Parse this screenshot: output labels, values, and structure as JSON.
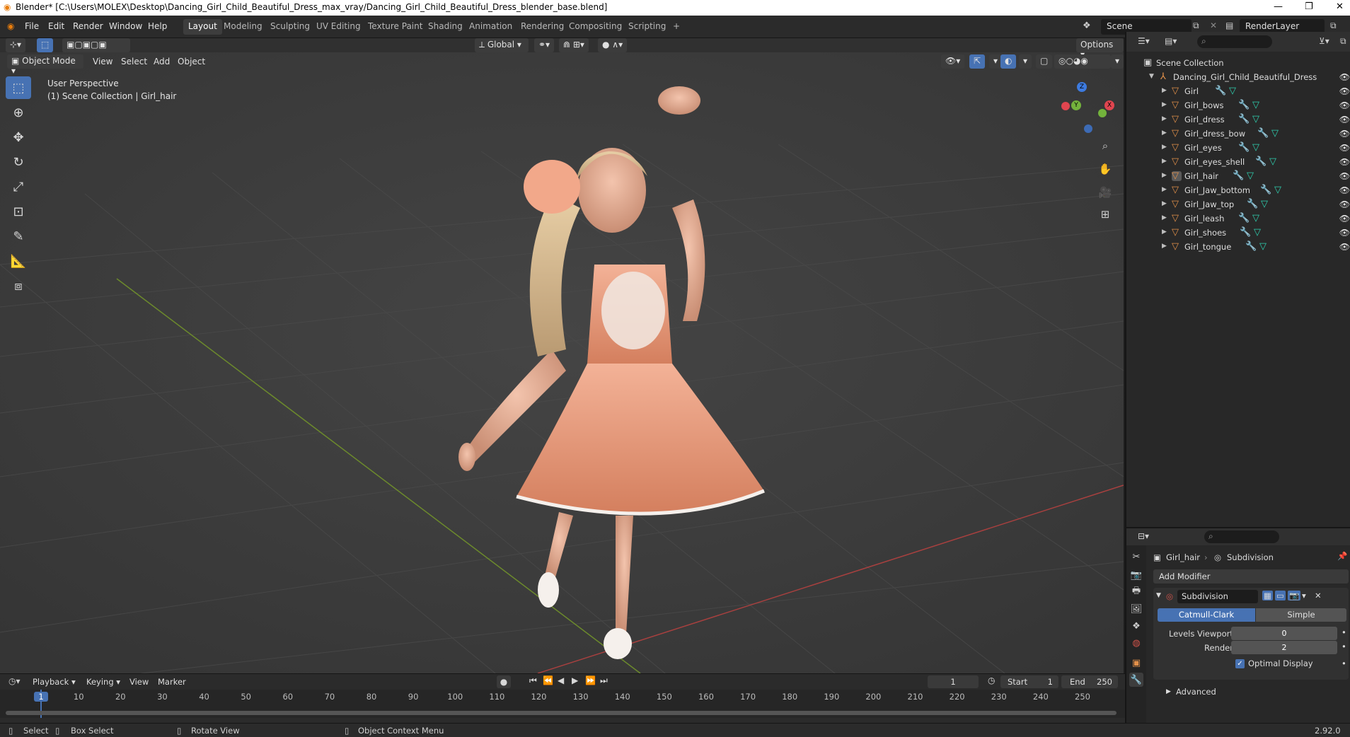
{
  "window": {
    "title": "Blender* [C:\\Users\\MOLEX\\Desktop\\Dancing_Girl_Child_Beautiful_Dress_max_vray/Dancing_Girl_Child_Beautiful_Dress_blender_base.blend]"
  },
  "menu": [
    "File",
    "Edit",
    "Render",
    "Window",
    "Help"
  ],
  "workspaces": [
    "Layout",
    "Modeling",
    "Sculpting",
    "UV Editing",
    "Texture Paint",
    "Shading",
    "Animation",
    "Rendering",
    "Compositing",
    "Scripting"
  ],
  "workspace_add": "+",
  "scene": {
    "name": "Scene",
    "view_layer": "RenderLayer"
  },
  "viewport_header": {
    "transform_orientation": "Global",
    "options": "Options",
    "mode": "Object Mode",
    "menus": [
      "View",
      "Select",
      "Add",
      "Object"
    ]
  },
  "viewport": {
    "perspective_label": "User Perspective",
    "collection_label": "(1) Scene Collection | Girl_hair",
    "gizmo": {
      "x": "X",
      "y": "Y",
      "z": "Z"
    }
  },
  "outliner": {
    "root": "Scene Collection",
    "collection": "Dancing_Girl_Child_Beautiful_Dress",
    "objects": [
      "Girl",
      "Girl_bows",
      "Girl_dress",
      "Girl_dress_bow",
      "Girl_eyes",
      "Girl_eyes_shell",
      "Girl_hair",
      "Girl_Jaw_bottom",
      "Girl_Jaw_top",
      "Girl_leash",
      "Girl_shoes",
      "Girl_tongue"
    ],
    "selected": "Girl_hair"
  },
  "properties": {
    "object": "Girl_hair",
    "modifier_context": "Subdivision",
    "add_modifier": "Add Modifier",
    "modifier_name": "Subdivision",
    "algorithm_options": [
      "Catmull-Clark",
      "Simple"
    ],
    "algorithm_selected": "Catmull-Clark",
    "levels_viewport_label": "Levels Viewport",
    "levels_viewport": "0",
    "render_label": "Render",
    "render": "2",
    "optimal_display_label": "Optimal Display",
    "optimal_display": true,
    "advanced_label": "Advanced"
  },
  "timeline": {
    "menus": [
      "Playback",
      "Keying",
      "View",
      "Marker"
    ],
    "current_frame": "1",
    "start_label": "Start",
    "start": "1",
    "end_label": "End",
    "end": "250",
    "ticks": [
      "1",
      "10",
      "20",
      "30",
      "40",
      "50",
      "60",
      "70",
      "80",
      "90",
      "100",
      "110",
      "120",
      "130",
      "140",
      "150",
      "160",
      "170",
      "180",
      "190",
      "200",
      "210",
      "220",
      "230",
      "240",
      "250"
    ]
  },
  "status": {
    "select": "Select",
    "box_select": "Box Select",
    "rotate_view": "Rotate View",
    "context_menu": "Object Context Menu",
    "version": "2.92.0"
  },
  "colors": {
    "accent": "#4772b3",
    "mesh_icon": "#e2904a",
    "modifier_icon": "#6fa2e8",
    "data_icon": "#2fd1b0",
    "dress": "#f0a385"
  }
}
